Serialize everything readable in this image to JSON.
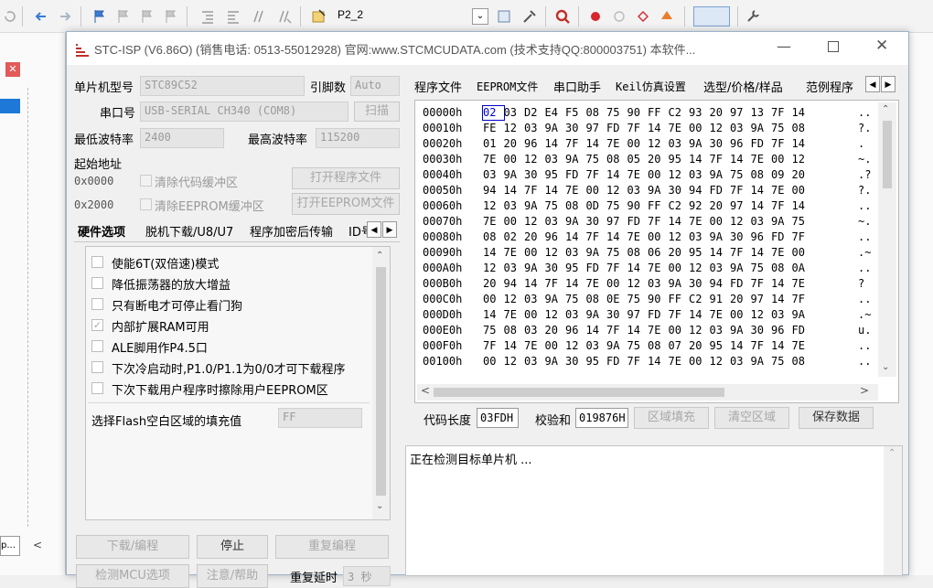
{
  "window": {
    "title": "STC-ISP (V6.86O) (销售电话: 0513-55012928) 官网:www.STCMCUDATA.com  (技术支持QQ:800003751) 本软件...",
    "ide_tab_label": "P2_2",
    "ide_left_item": "p..."
  },
  "chip": {
    "mcu_label": "单片机型号",
    "mcu_value": "STC89C52",
    "pin_label": "引脚数",
    "pin_value": "Auto",
    "port_label": "串口号",
    "port_value": "USB-SERIAL CH340 (COM8)",
    "scan_label": "扫描",
    "min_baud_label": "最低波特率",
    "min_baud_value": "2400",
    "max_baud_label": "最高波特率",
    "max_baud_value": "115200"
  },
  "start_address": {
    "label": "起始地址",
    "addr1": "0x0000",
    "clear_code_label": "清除代码缓冲区",
    "open_program_label": "打开程序文件",
    "addr2": "0x2000",
    "clear_eeprom_label": "清除EEPROM缓冲区",
    "open_eeprom_label": "打开EEPROM文件"
  },
  "left_tabs": [
    "硬件选项",
    "脱机下载/U8/U7",
    "程序加密后传输",
    "ID号"
  ],
  "hardware_options": [
    {
      "label": "使能6T(双倍速)模式",
      "checked": false
    },
    {
      "label": "降低振荡器的放大增益",
      "checked": false
    },
    {
      "label": "只有断电才可停止看门狗",
      "checked": false
    },
    {
      "label": "内部扩展RAM可用",
      "checked": true
    },
    {
      "label": "ALE脚用作P4.5口",
      "checked": false
    },
    {
      "label": "下次冷启动时,P1.0/P1.1为0/0才可下载程序",
      "checked": false
    },
    {
      "label": "下次下载用户程序时擦除用户EEPROM区",
      "checked": false
    }
  ],
  "flash_fill": {
    "label": "选择Flash空白区域的填充值",
    "value": "FF"
  },
  "bottom_buttons": {
    "download": "下载/编程",
    "stop": "停止",
    "reprogram": "重复编程",
    "check_mcu": "检测MCU选项",
    "help": "注意/帮助",
    "retry_delay_label": "重复延时",
    "retry_delay_value": "3 秒"
  },
  "right_tabs": [
    "程序文件",
    "EEPROM文件",
    "串口助手",
    "Keil仿真设置",
    "选型/价格/样品",
    "范例程序"
  ],
  "hex": {
    "rows": [
      {
        "addr": "00000h",
        "bytes": [
          "02",
          "03",
          "D2",
          "E4",
          "F5",
          "08",
          "75",
          "90",
          "FF",
          "C2",
          "93",
          "20",
          "97",
          "13",
          "7F",
          "14"
        ],
        "ascii": ".."
      },
      {
        "addr": "00010h",
        "bytes": [
          "FE",
          "12",
          "03",
          "9A",
          "30",
          "97",
          "FD",
          "7F",
          "14",
          "7E",
          "00",
          "12",
          "03",
          "9A",
          "75",
          "08"
        ],
        "ascii": "?."
      },
      {
        "addr": "00020h",
        "bytes": [
          "01",
          "20",
          "96",
          "14",
          "7F",
          "14",
          "7E",
          "00",
          "12",
          "03",
          "9A",
          "30",
          "96",
          "FD",
          "7F",
          "14"
        ],
        "ascii": "."
      },
      {
        "addr": "00030h",
        "bytes": [
          "7E",
          "00",
          "12",
          "03",
          "9A",
          "75",
          "08",
          "05",
          "20",
          "95",
          "14",
          "7F",
          "14",
          "7E",
          "00",
          "12"
        ],
        "ascii": "~."
      },
      {
        "addr": "00040h",
        "bytes": [
          "03",
          "9A",
          "30",
          "95",
          "FD",
          "7F",
          "14",
          "7E",
          "00",
          "12",
          "03",
          "9A",
          "75",
          "08",
          "09",
          "20"
        ],
        "ascii": ".?"
      },
      {
        "addr": "00050h",
        "bytes": [
          "94",
          "14",
          "7F",
          "14",
          "7E",
          "00",
          "12",
          "03",
          "9A",
          "30",
          "94",
          "FD",
          "7F",
          "14",
          "7E",
          "00"
        ],
        "ascii": "?."
      },
      {
        "addr": "00060h",
        "bytes": [
          "12",
          "03",
          "9A",
          "75",
          "08",
          "0D",
          "75",
          "90",
          "FF",
          "C2",
          "92",
          "20",
          "97",
          "14",
          "7F",
          "14"
        ],
        "ascii": ".."
      },
      {
        "addr": "00070h",
        "bytes": [
          "7E",
          "00",
          "12",
          "03",
          "9A",
          "30",
          "97",
          "FD",
          "7F",
          "14",
          "7E",
          "00",
          "12",
          "03",
          "9A",
          "75"
        ],
        "ascii": "~."
      },
      {
        "addr": "00080h",
        "bytes": [
          "08",
          "02",
          "20",
          "96",
          "14",
          "7F",
          "14",
          "7E",
          "00",
          "12",
          "03",
          "9A",
          "30",
          "96",
          "FD",
          "7F"
        ],
        "ascii": ".."
      },
      {
        "addr": "00090h",
        "bytes": [
          "14",
          "7E",
          "00",
          "12",
          "03",
          "9A",
          "75",
          "08",
          "06",
          "20",
          "95",
          "14",
          "7F",
          "14",
          "7E",
          "00"
        ],
        "ascii": ".~"
      },
      {
        "addr": "000A0h",
        "bytes": [
          "12",
          "03",
          "9A",
          "30",
          "95",
          "FD",
          "7F",
          "14",
          "7E",
          "00",
          "12",
          "03",
          "9A",
          "75",
          "08",
          "0A"
        ],
        "ascii": ".."
      },
      {
        "addr": "000B0h",
        "bytes": [
          "20",
          "94",
          "14",
          "7F",
          "14",
          "7E",
          "00",
          "12",
          "03",
          "9A",
          "30",
          "94",
          "FD",
          "7F",
          "14",
          "7E"
        ],
        "ascii": "?"
      },
      {
        "addr": "000C0h",
        "bytes": [
          "00",
          "12",
          "03",
          "9A",
          "75",
          "08",
          "0E",
          "75",
          "90",
          "FF",
          "C2",
          "91",
          "20",
          "97",
          "14",
          "7F"
        ],
        "ascii": ".."
      },
      {
        "addr": "000D0h",
        "bytes": [
          "14",
          "7E",
          "00",
          "12",
          "03",
          "9A",
          "30",
          "97",
          "FD",
          "7F",
          "14",
          "7E",
          "00",
          "12",
          "03",
          "9A"
        ],
        "ascii": ".~"
      },
      {
        "addr": "000E0h",
        "bytes": [
          "75",
          "08",
          "03",
          "20",
          "96",
          "14",
          "7F",
          "14",
          "7E",
          "00",
          "12",
          "03",
          "9A",
          "30",
          "96",
          "FD"
        ],
        "ascii": "u."
      },
      {
        "addr": "000F0h",
        "bytes": [
          "7F",
          "14",
          "7E",
          "00",
          "12",
          "03",
          "9A",
          "75",
          "08",
          "07",
          "20",
          "95",
          "14",
          "7F",
          "14",
          "7E"
        ],
        "ascii": ".."
      },
      {
        "addr": "00100h",
        "bytes": [
          "00",
          "12",
          "03",
          "9A",
          "30",
          "95",
          "FD",
          "7F",
          "14",
          "7E",
          "00",
          "12",
          "03",
          "9A",
          "75",
          "08"
        ],
        "ascii": ".."
      }
    ]
  },
  "code_info": {
    "length_label": "代码长度",
    "length_value": "03FDH",
    "checksum_label": "校验和",
    "checksum_value": "019876H",
    "fill_label": "区域填充",
    "clear_label": "清空区域",
    "save_label": "保存数据"
  },
  "status": {
    "text": "正在检测目标单片机 ..."
  },
  "colors": {
    "accent": "#0000cc",
    "window_border": "#9fb3c8"
  }
}
